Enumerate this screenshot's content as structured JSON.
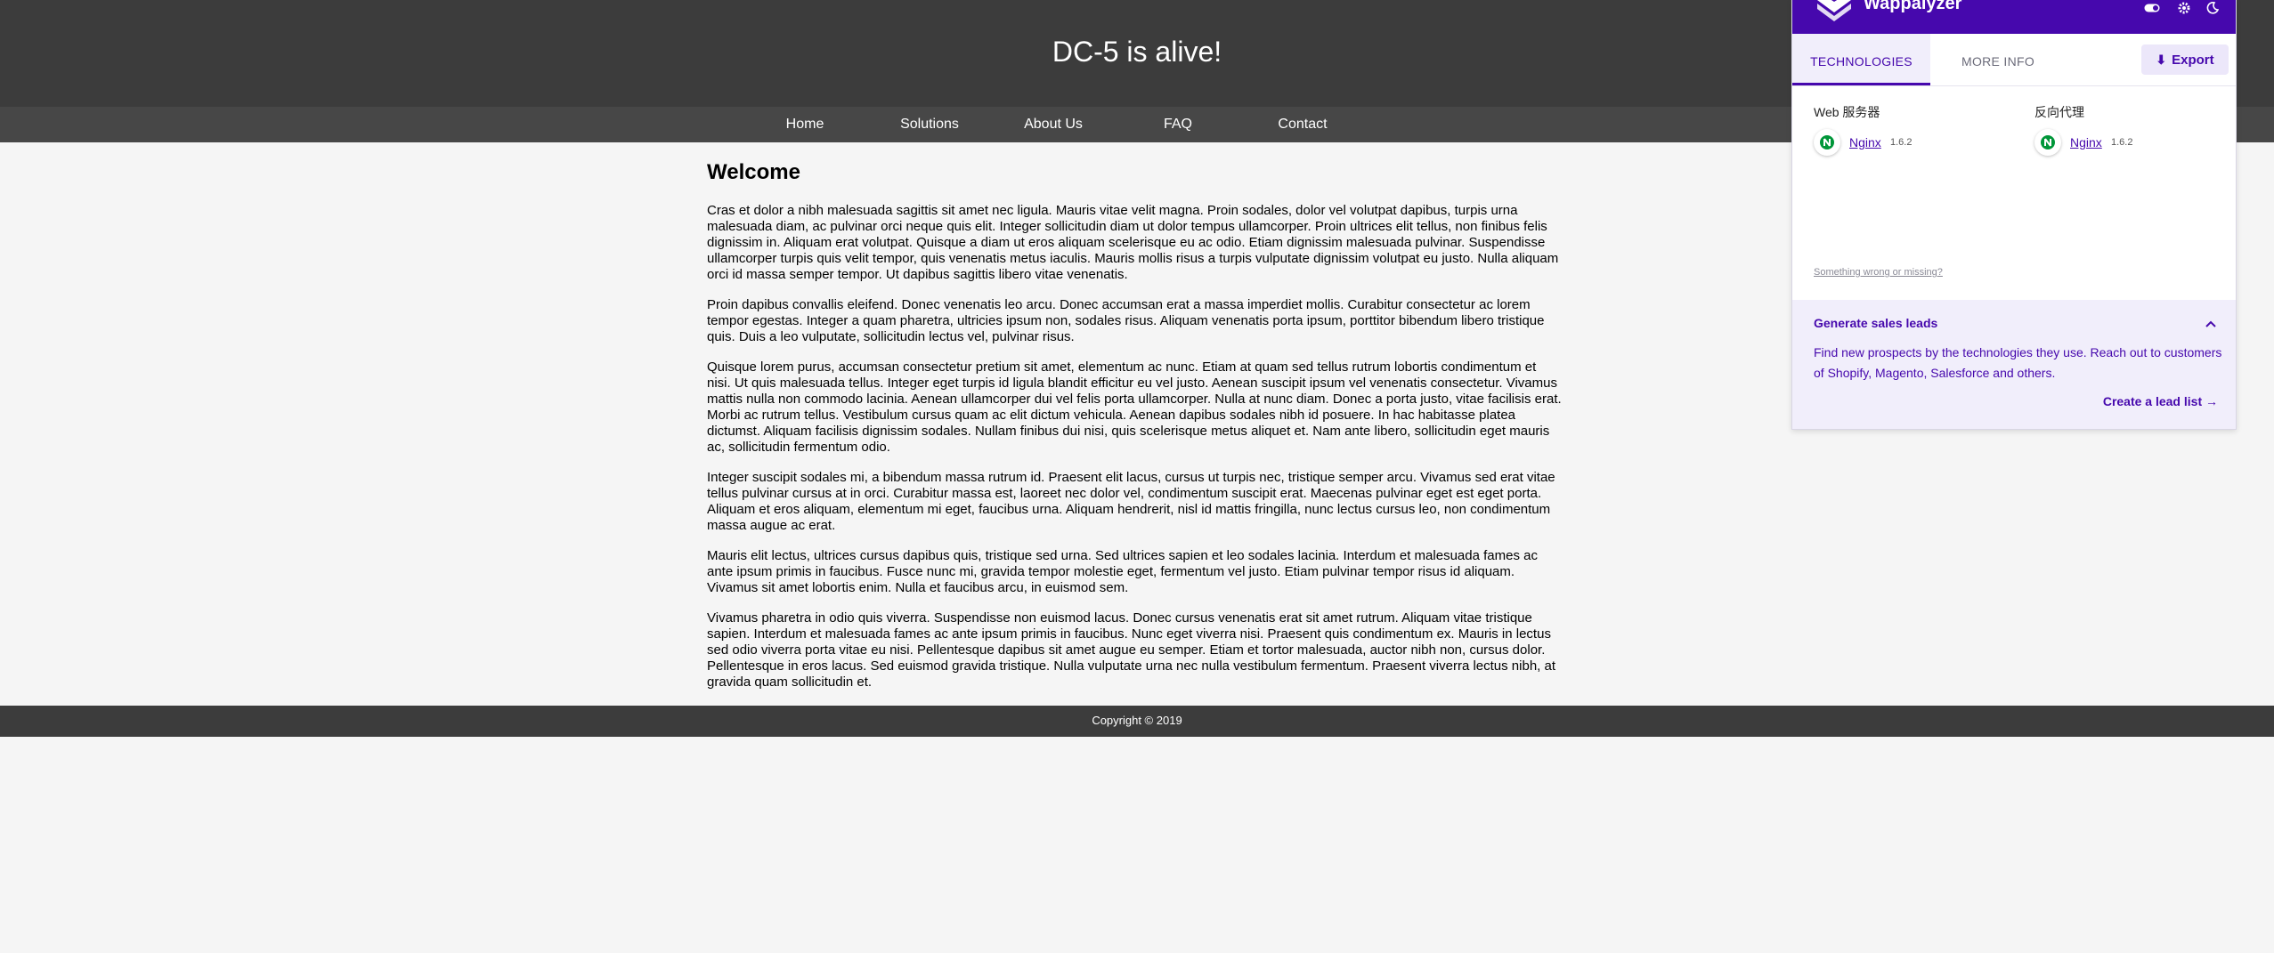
{
  "site": {
    "title": "DC-5 is alive!",
    "nav": [
      "Home",
      "Solutions",
      "About Us",
      "FAQ",
      "Contact"
    ],
    "heading": "Welcome",
    "paragraphs": [
      "Cras et dolor a nibh malesuada sagittis sit amet nec ligula. Mauris vitae velit magna. Proin sodales, dolor vel volutpat dapibus, turpis urna malesuada diam, ac pulvinar orci neque quis elit. Integer sollicitudin diam ut dolor tempus ullamcorper. Proin ultrices elit tellus, non finibus felis dignissim in. Aliquam erat volutpat. Quisque a diam ut eros aliquam scelerisque eu ac odio. Etiam dignissim malesuada pulvinar. Suspendisse ullamcorper turpis quis velit tempor, quis venenatis metus iaculis. Mauris mollis risus a turpis vulputate dignissim volutpat eu justo. Nulla aliquam orci id massa semper tempor. Ut dapibus sagittis libero vitae venenatis.",
      "Proin dapibus convallis eleifend. Donec venenatis leo arcu. Donec accumsan erat a massa imperdiet mollis. Curabitur consectetur ac lorem tempor egestas. Integer a quam pharetra, ultricies ipsum non, sodales risus. Aliquam venenatis porta ipsum, porttitor bibendum libero tristique quis. Duis a leo vulputate, sollicitudin lectus vel, pulvinar risus.",
      "Quisque lorem purus, accumsan consectetur pretium sit amet, elementum ac nunc. Etiam at quam sed tellus rutrum lobortis condimentum et nisi. Ut quis malesuada tellus. Integer eget turpis id ligula blandit efficitur eu vel justo. Aenean suscipit ipsum vel venenatis consectetur. Vivamus mattis nulla non commodo lacinia. Aenean ullamcorper dui vel felis porta ullamcorper. Nulla at nunc diam. Donec a porta justo, vitae facilisis erat. Morbi ac rutrum tellus. Vestibulum cursus quam ac elit dictum vehicula. Aenean dapibus sodales nibh id posuere. In hac habitasse platea dictumst. Aliquam facilisis dignissim sodales. Nullam finibus dui nisi, quis scelerisque metus aliquet et. Nam ante libero, sollicitudin eget mauris ac, sollicitudin fermentum odio.",
      "Integer suscipit sodales mi, a bibendum massa rutrum id. Praesent elit lacus, cursus ut turpis nec, tristique semper arcu. Vivamus sed erat vitae tellus pulvinar cursus at in orci. Curabitur massa est, laoreet nec dolor vel, condimentum suscipit erat. Maecenas pulvinar eget est eget porta. Aliquam et eros aliquam, elementum mi eget, faucibus urna. Aliquam hendrerit, nisl id mattis fringilla, nunc lectus cursus leo, non condimentum massa augue ac erat.",
      "Mauris elit lectus, ultrices cursus dapibus quis, tristique sed urna. Sed ultrices sapien et leo sodales lacinia. Interdum et malesuada fames ac ante ipsum primis in faucibus. Fusce nunc mi, gravida tempor molestie eget, fermentum vel justo. Etiam pulvinar tempor risus id aliquam. Vivamus sit amet lobortis enim. Nulla et faucibus arcu, in euismod sem.",
      "Vivamus pharetra in odio quis viverra. Suspendisse non euismod lacus. Donec cursus venenatis erat sit amet rutrum. Aliquam vitae tristique sapien. Interdum et malesuada fames ac ante ipsum primis in faucibus. Nunc eget viverra nisi. Praesent quis condimentum ex. Mauris in lectus sed odio viverra porta vitae eu nisi. Pellentesque dapibus sit amet augue eu semper. Etiam et tortor malesuada, auctor nibh non, cursus dolor. Pellentesque in eros lacus. Sed euismod gravida tristique. Nulla vulputate urna nec nulla vestibulum fermentum. Praesent viverra lectus nibh, at gravida quam sollicitudin et."
    ],
    "footer": "Copyright © 2019"
  },
  "wappalyzer": {
    "brand": "Wappalyzer",
    "icons": [
      "toggle-icon",
      "gear-icon",
      "moon-icon"
    ],
    "tabs": [
      "TECHNOLOGIES",
      "MORE INFO"
    ],
    "export_label": "Export",
    "categories": [
      {
        "name": "Web 服务器",
        "tech": "Nginx",
        "version": "1.6.2"
      },
      {
        "name": "反向代理",
        "tech": "Nginx",
        "version": "1.6.2"
      }
    ],
    "wrong_link": "Something wrong or missing?",
    "leads": {
      "title": "Generate sales leads",
      "text": "Find new prospects by the technologies they use. Reach out to customers of Shopify, Magento, Salesforce and others.",
      "link": "Create a lead list"
    },
    "colors": {
      "brand": "#4608ad",
      "nginx": "#009639"
    }
  }
}
